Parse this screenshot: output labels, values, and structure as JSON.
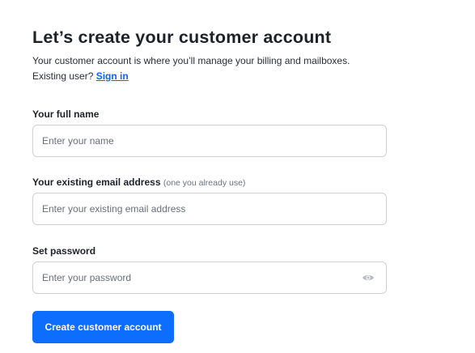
{
  "header": {
    "title": "Let’s create your customer account",
    "subtitle_line1": "Your customer account is where you’ll manage your billing and mailboxes.",
    "existing_user_text": "Existing user?",
    "signin_link": "Sign in"
  },
  "fields": {
    "name": {
      "label": "Your full name",
      "placeholder": "Enter your name",
      "value": ""
    },
    "email": {
      "label": "Your existing email address",
      "hint": "(one you already use)",
      "placeholder": "Enter your existing email address",
      "value": ""
    },
    "password": {
      "label": "Set password",
      "placeholder": "Enter your password",
      "value": "",
      "toggle_icon": "eye-icon"
    }
  },
  "actions": {
    "submit_label": "Create customer account"
  },
  "colors": {
    "accent": "#0d6efd",
    "link": "#1263f0",
    "border": "#cdd0d5"
  }
}
